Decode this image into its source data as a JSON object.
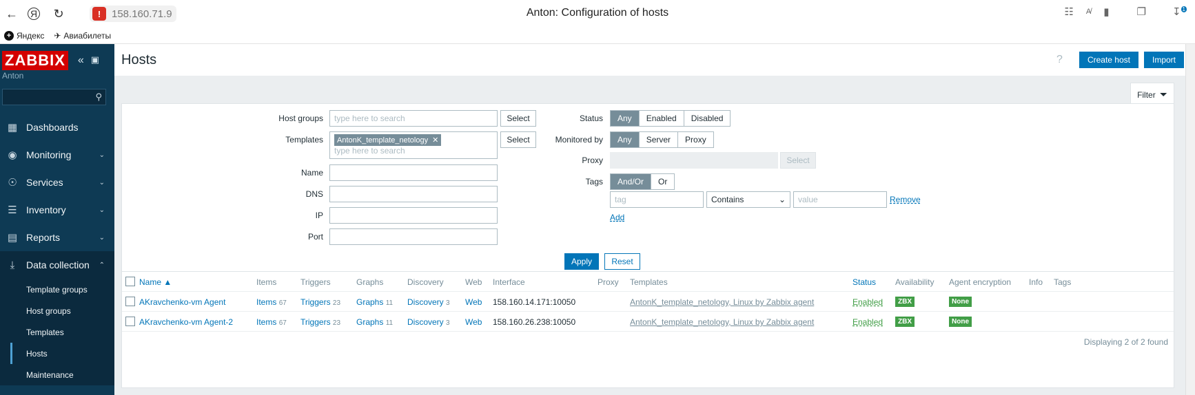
{
  "browser": {
    "url": "158.160.71.9",
    "page_title": "Anton: Configuration of hosts",
    "bookmarks": [
      "Яндекс",
      "Авиабилеты"
    ],
    "download_count": "1"
  },
  "sidebar": {
    "logo": "ZABBIX",
    "user": "Anton",
    "menu": [
      {
        "label": "Dashboards",
        "icon": "dashboard-icon"
      },
      {
        "label": "Monitoring",
        "icon": "eye-icon"
      },
      {
        "label": "Services",
        "icon": "services-icon"
      },
      {
        "label": "Inventory",
        "icon": "list-icon"
      },
      {
        "label": "Reports",
        "icon": "report-icon"
      },
      {
        "label": "Data collection",
        "icon": "download-icon"
      }
    ],
    "submenu": [
      "Template groups",
      "Host groups",
      "Templates",
      "Hosts",
      "Maintenance"
    ]
  },
  "header": {
    "title": "Hosts",
    "help": "?",
    "create_host": "Create host",
    "import": "Import"
  },
  "filter": {
    "tab_label": "Filter",
    "host_groups_label": "Host groups",
    "host_groups_placeholder": "type here to search",
    "templates_label": "Templates",
    "template_chip": "AntonK_template_netology",
    "templates_placeholder": "type here to search",
    "select_label": "Select",
    "name_label": "Name",
    "dns_label": "DNS",
    "ip_label": "IP",
    "port_label": "Port",
    "status_label": "Status",
    "status_options": [
      "Any",
      "Enabled",
      "Disabled"
    ],
    "monitored_label": "Monitored by",
    "monitored_options": [
      "Any",
      "Server",
      "Proxy"
    ],
    "proxy_label": "Proxy",
    "tags_label": "Tags",
    "tags_options": [
      "And/Or",
      "Or"
    ],
    "tag_placeholder": "tag",
    "tag_operator": "Contains",
    "value_placeholder": "value",
    "remove": "Remove",
    "add": "Add",
    "apply": "Apply",
    "reset": "Reset"
  },
  "table": {
    "headers": [
      "Name ▲",
      "Items",
      "Triggers",
      "Graphs",
      "Discovery",
      "Web",
      "Interface",
      "Proxy",
      "Templates",
      "Status",
      "Availability",
      "Agent encryption",
      "Info",
      "Tags"
    ],
    "rows": [
      {
        "name": "AKravchenko-vm Agent",
        "items": "Items",
        "items_n": "67",
        "triggers": "Triggers",
        "triggers_n": "23",
        "graphs": "Graphs",
        "graphs_n": "11",
        "discovery": "Discovery",
        "discovery_n": "3",
        "web": "Web",
        "interface": "158.160.14.171:10050",
        "templates": "AntonK_template_netology, Linux by Zabbix agent",
        "status": "Enabled",
        "availability": "ZBX",
        "encryption": "None"
      },
      {
        "name": "AKravchenko-vm Agent-2",
        "items": "Items",
        "items_n": "67",
        "triggers": "Triggers",
        "triggers_n": "23",
        "graphs": "Graphs",
        "graphs_n": "11",
        "discovery": "Discovery",
        "discovery_n": "3",
        "web": "Web",
        "interface": "158.160.26.238:10050",
        "templates": "AntonK_template_netology, Linux by Zabbix agent",
        "status": "Enabled",
        "availability": "ZBX",
        "encryption": "None"
      }
    ],
    "footer": "Displaying 2 of 2 found"
  }
}
